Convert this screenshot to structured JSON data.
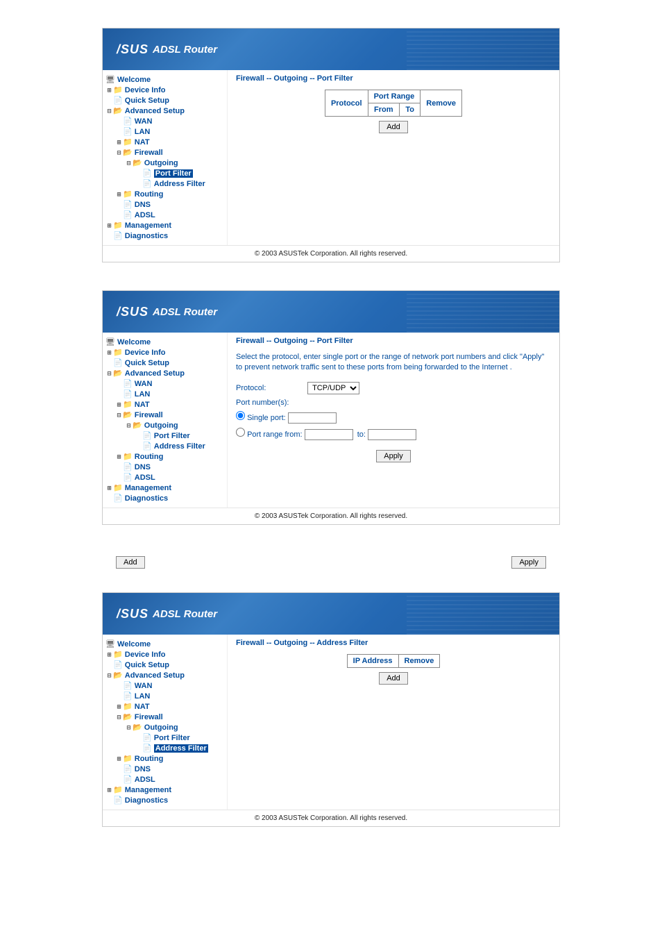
{
  "brand_logo_text": "/SUS",
  "brand_product": "ADSL Router",
  "copyright": "© 2003 ASUSTek Corporation. All rights reserved.",
  "sidebar": {
    "welcome": "Welcome",
    "device_info": "Device Info",
    "quick_setup": "Quick Setup",
    "advanced_setup": "Advanced Setup",
    "wan": "WAN",
    "lan": "LAN",
    "nat": "NAT",
    "firewall": "Firewall",
    "outgoing": "Outgoing",
    "port_filter": "Port Filter",
    "address_filter": "Address Filter",
    "routing": "Routing",
    "dns": "DNS",
    "adsl": "ADSL",
    "management": "Management",
    "diagnostics": "Diagnostics"
  },
  "panel1": {
    "breadcrumb": "Firewall -- Outgoing -- Port Filter",
    "table": {
      "protocol": "Protocol",
      "port_range": "Port Range",
      "remove": "Remove",
      "from": "From",
      "to": "To"
    },
    "add_button": "Add"
  },
  "panel2": {
    "breadcrumb": "Firewall -- Outgoing -- Port Filter",
    "help": "Select the protocol, enter single port or the range of network port numbers and click \"Apply\" to prevent network traffic sent to these ports from being forwarded to the Internet .",
    "protocol_label": "Protocol:",
    "protocol_value": "TCP/UDP",
    "port_numbers_label": "Port number(s):",
    "single_port_label": "Single port:",
    "port_range_from_label": "Port range from:",
    "to_label": "to:",
    "apply_button": "Apply"
  },
  "inline": {
    "add": "Add",
    "apply": "Apply"
  },
  "panel3": {
    "breadcrumb": "Firewall -- Outgoing -- Address Filter",
    "table": {
      "ip_address": "IP Address",
      "remove": "Remove"
    },
    "add_button": "Add"
  }
}
